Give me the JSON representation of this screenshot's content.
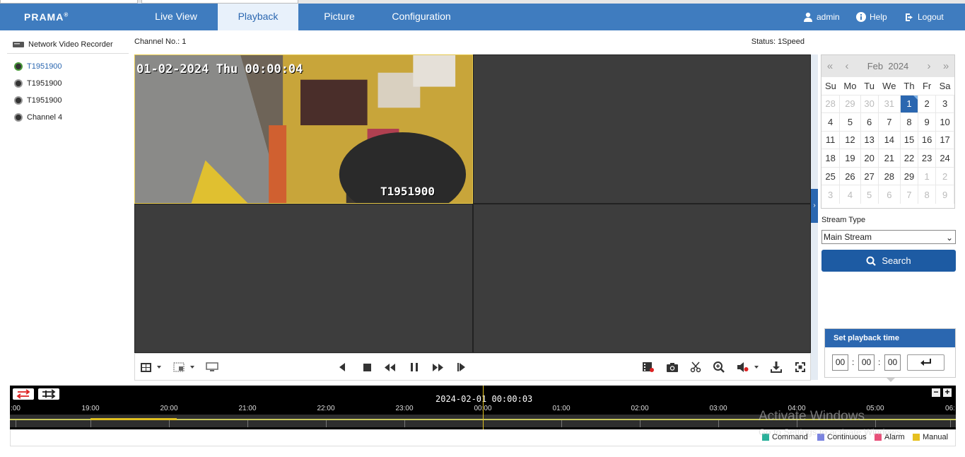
{
  "app": {
    "logo": "PRAMA"
  },
  "nav": {
    "items": [
      {
        "label": "Live View"
      },
      {
        "label": "Playback"
      },
      {
        "label": "Picture"
      },
      {
        "label": "Configuration"
      }
    ],
    "active": "Playback",
    "user": "admin",
    "help": "Help",
    "logout": "Logout"
  },
  "sidebar": {
    "root": "Network Video Recorder",
    "cameras": [
      {
        "label": "T1951900",
        "selected": true
      },
      {
        "label": "T1951900",
        "selected": false
      },
      {
        "label": "T1951900",
        "selected": false
      },
      {
        "label": "Channel 4",
        "selected": false
      }
    ]
  },
  "player": {
    "channel_label": "Channel No.: 1",
    "status_label": "Status: 1Speed",
    "osd_datetime": "01-02-2024 Thu 00:00:04",
    "osd_camera": "T1951900"
  },
  "calendar": {
    "month": "Feb",
    "year": "2024",
    "weekdays": [
      "Su",
      "Mo",
      "Tu",
      "We",
      "Th",
      "Fr",
      "Sa"
    ],
    "weeks": [
      [
        "28",
        "29",
        "30",
        "31",
        "1",
        "2",
        "3"
      ],
      [
        "4",
        "5",
        "6",
        "7",
        "8",
        "9",
        "10"
      ],
      [
        "11",
        "12",
        "13",
        "14",
        "15",
        "16",
        "17"
      ],
      [
        "18",
        "19",
        "20",
        "21",
        "22",
        "23",
        "24"
      ],
      [
        "25",
        "26",
        "27",
        "28",
        "29",
        "1",
        "2"
      ],
      [
        "3",
        "4",
        "5",
        "6",
        "7",
        "8",
        "9"
      ]
    ],
    "selected_day": "1"
  },
  "stream": {
    "label": "Stream Type",
    "value": "Main Stream",
    "search_label": "Search"
  },
  "playback_time": {
    "title": "Set playback time",
    "hh": "00",
    "mm": "00",
    "ss": "00"
  },
  "timeline": {
    "current": "2024-02-01 00:00:03",
    "ticks": [
      ":00",
      "19:00",
      "20:00",
      "21:00",
      "22:00",
      "23:00",
      "00:00",
      "01:00",
      "02:00",
      "03:00",
      "04:00",
      "05:00",
      "06:"
    ]
  },
  "legend": [
    {
      "label": "Command",
      "color": "#2ab09a"
    },
    {
      "label": "Continuous",
      "color": "#7b84e0"
    },
    {
      "label": "Alarm",
      "color": "#e8507a"
    },
    {
      "label": "Manual",
      "color": "#e6c020"
    }
  ],
  "watermark": {
    "line1": "Activate Windows",
    "line2": "Go to Settings to activate Windows."
  }
}
